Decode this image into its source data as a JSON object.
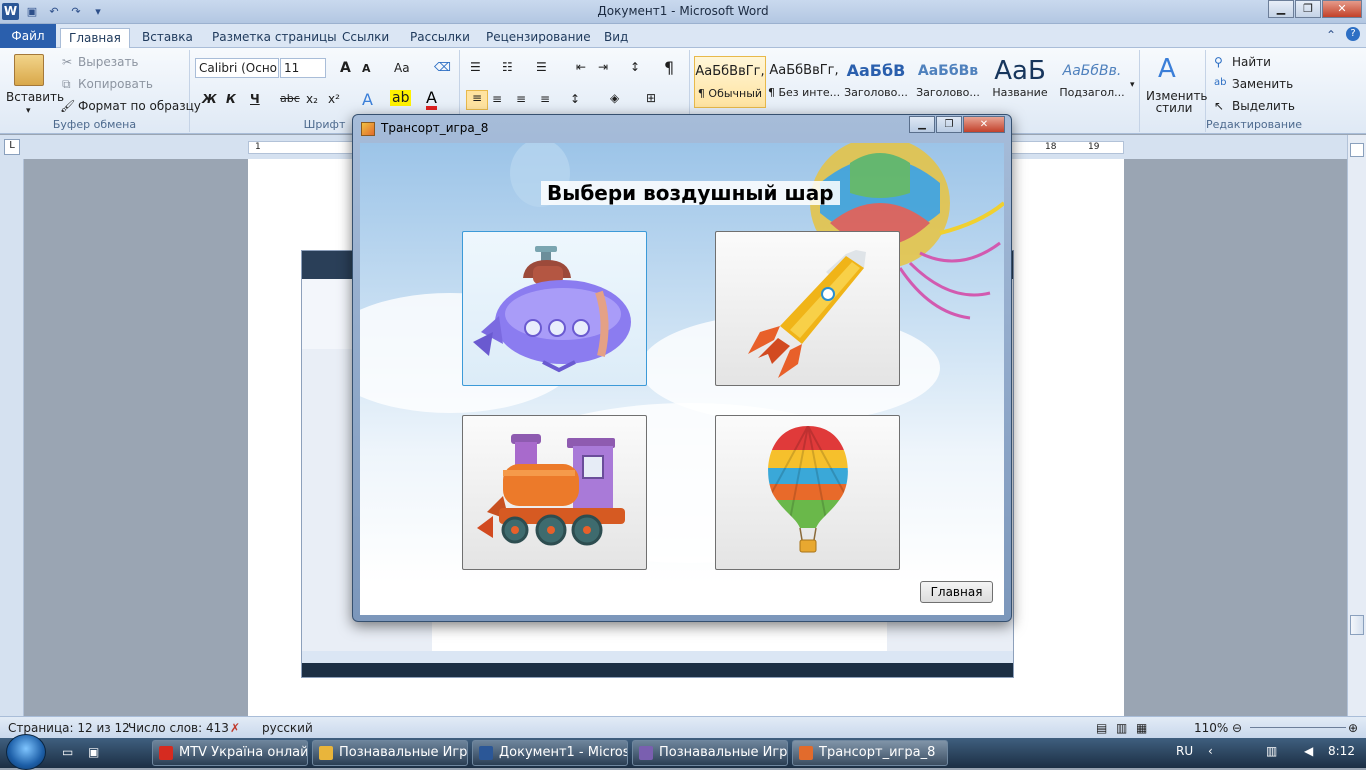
{
  "word": {
    "window_title": "Документ1 - Microsoft Word",
    "tabs": [
      "Файл",
      "Главная",
      "Вставка",
      "Разметка страницы",
      "Ссылки",
      "Рассылки",
      "Рецензирование",
      "Вид"
    ],
    "clipboard": {
      "paste": "Вставить",
      "cut": "Вырезать",
      "copy": "Копировать",
      "format_painter": "Формат по образцу",
      "label": "Буфер обмена"
    },
    "font": {
      "name": "Calibri (Осно",
      "size": "11",
      "label": "Шрифт",
      "bold": "Ж",
      "italic": "К",
      "underline": "Ч",
      "strike": "abc",
      "sub": "x₂",
      "sup": "x²",
      "grow": "A",
      "shrink": "A",
      "case": "Aa"
    },
    "styles": [
      {
        "preview": "АаБбВвГг,",
        "name": "¶ Обычный"
      },
      {
        "preview": "АаБбВвГг,",
        "name": "¶ Без инте..."
      },
      {
        "preview": "АаБбВ",
        "name": "Заголово..."
      },
      {
        "preview": "АаБбВв",
        "name": "Заголово..."
      },
      {
        "preview": "АаБ",
        "name": "Название"
      },
      {
        "preview": "АаБбВв.",
        "name": "Подзагол..."
      }
    ],
    "change_styles": "Изменить стили",
    "editing": {
      "find": "Найти",
      "replace": "Заменить",
      "select": "Выделить",
      "label": "Редактирование"
    },
    "status": {
      "page": "Страница: 12 из 12",
      "words": "Число слов: 413",
      "lang": "русский",
      "zoom": "110%"
    },
    "ruler_marks": [
      "1",
      "18",
      "19"
    ]
  },
  "dialog": {
    "title": "Трансорт_игра_8",
    "heading": "Выбери воздушный шар",
    "options": [
      {
        "name": "submarine"
      },
      {
        "name": "rocket"
      },
      {
        "name": "train"
      },
      {
        "name": "hot-air-balloon"
      }
    ],
    "home_button": "Главная"
  },
  "taskbar": {
    "items": [
      {
        "label": "MTV Україна онлай...",
        "color": "#d62b20"
      },
      {
        "label": "Познавальные Игры",
        "color": "#e9b53b"
      },
      {
        "label": "Документ1 - Micros...",
        "color": "#2b5797"
      },
      {
        "label": "Познавальные Игр...",
        "color": "#7a5fb0"
      },
      {
        "label": "Трансорт_игра_8",
        "color": "#e26b2c"
      }
    ],
    "lang": "RU",
    "time": "8:12"
  }
}
